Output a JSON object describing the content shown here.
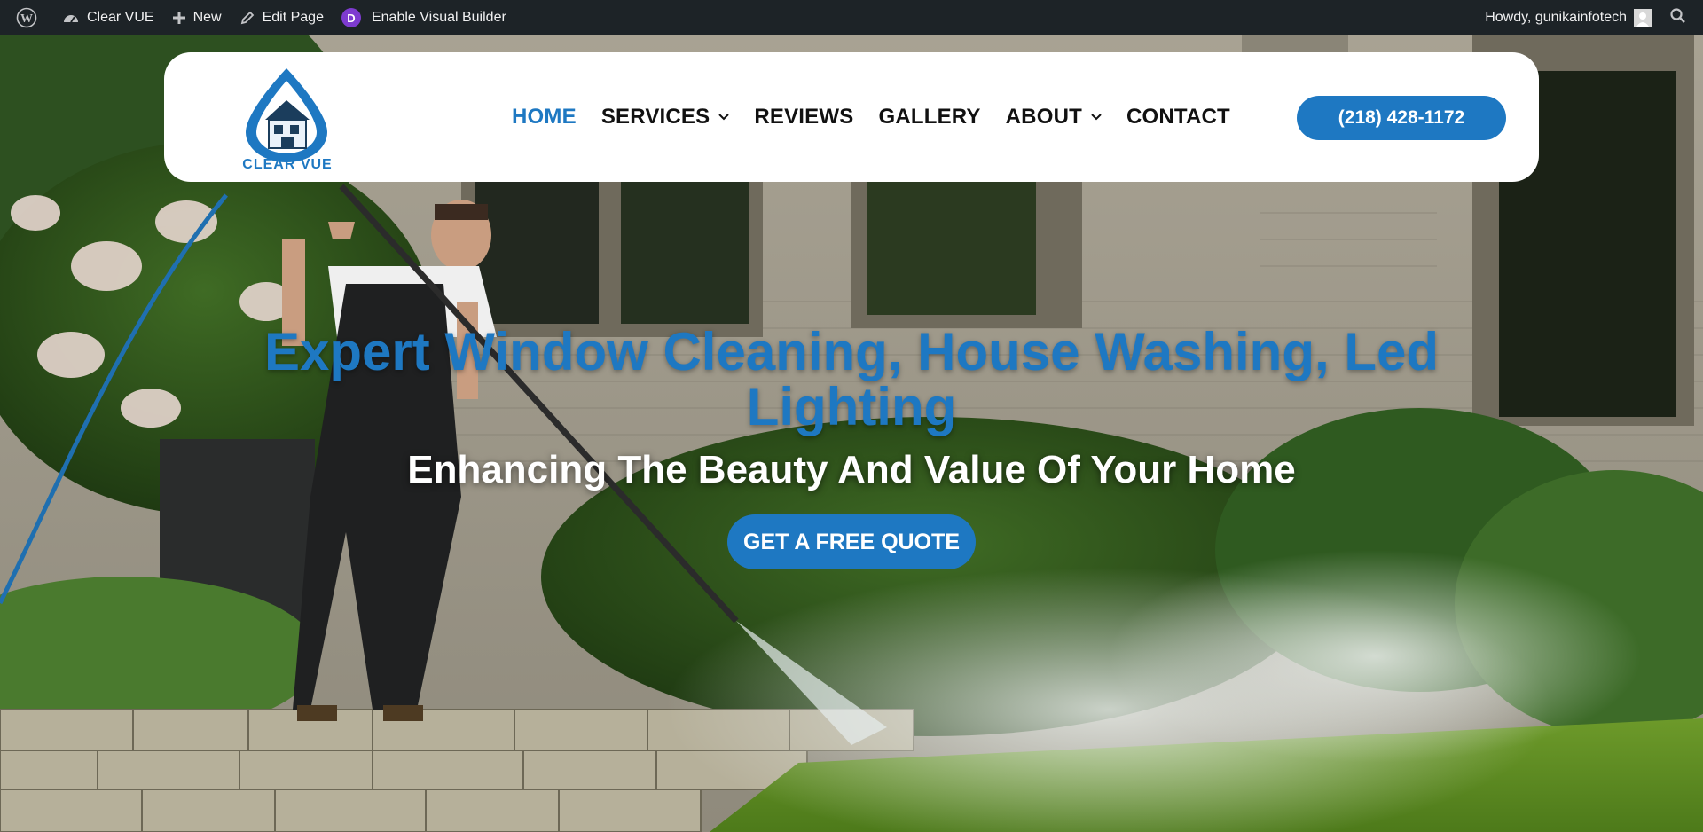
{
  "adminbar": {
    "site_name": "Clear VUE",
    "new_label": "New",
    "edit_label": "Edit Page",
    "divi_letter": "D",
    "visual_builder_label": "Enable Visual Builder",
    "greeting": "Howdy, gunikainfotech"
  },
  "header": {
    "logo_text": "CLEAR VUE",
    "nav": [
      {
        "label": "HOME",
        "active": true
      },
      {
        "label": "SERVICES",
        "dropdown": true
      },
      {
        "label": "REVIEWS"
      },
      {
        "label": "GALLERY"
      },
      {
        "label": "ABOUT",
        "dropdown": true
      },
      {
        "label": "CONTACT"
      }
    ],
    "phone": "(218) 428-1172"
  },
  "hero": {
    "title": "Expert Window Cleaning, House Washing, Led Lighting",
    "subtitle": "Enhancing The Beauty And Value Of Your Home",
    "cta_label": "GET A FREE QUOTE"
  },
  "colors": {
    "brand_blue": "#1e78c2",
    "admin_bar": "#1d2327",
    "divi_purple": "#7e3bd0"
  },
  "icons": [
    "wordpress-icon",
    "dashboard-icon",
    "plus-icon",
    "pencil-icon",
    "divi-icon",
    "avatar-icon",
    "search-icon",
    "chevron-down-icon"
  ]
}
